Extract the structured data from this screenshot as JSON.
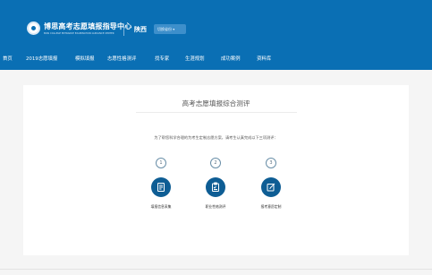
{
  "header": {
    "org_title": "博思高考志愿填报指导中心",
    "org_subtitle": "BOSI COLLEGE ENTRANCE EXAMINATION GUIDANCE CENTER",
    "province": "陕西",
    "switch_label": "切换省份 ▾"
  },
  "nav": {
    "items": [
      {
        "label": "首页"
      },
      {
        "label": "2019志愿填报"
      },
      {
        "label": "模拟填报"
      },
      {
        "label": "志愿性格测评"
      },
      {
        "label": "找专家"
      },
      {
        "label": "生涯规划"
      },
      {
        "label": "成功案例"
      },
      {
        "label": "资料库"
      }
    ]
  },
  "main": {
    "title": "高考志愿填报综合测评",
    "instruction": "为了帮您科学合理的为考生定制志愿方案，请考生认真完成以下三项测评：",
    "steps": [
      {
        "number": "1",
        "label": "填报信息采集",
        "icon": "form-icon"
      },
      {
        "number": "2",
        "label": "职业性格测评",
        "icon": "clipboard-icon"
      },
      {
        "number": "3",
        "label": "报考意愿定制",
        "icon": "edit-icon"
      }
    ]
  },
  "colors": {
    "header_bg": "#0a6fb4",
    "step_icon_bg": "#0e5d94",
    "page_bg": "#f5f5f5"
  }
}
